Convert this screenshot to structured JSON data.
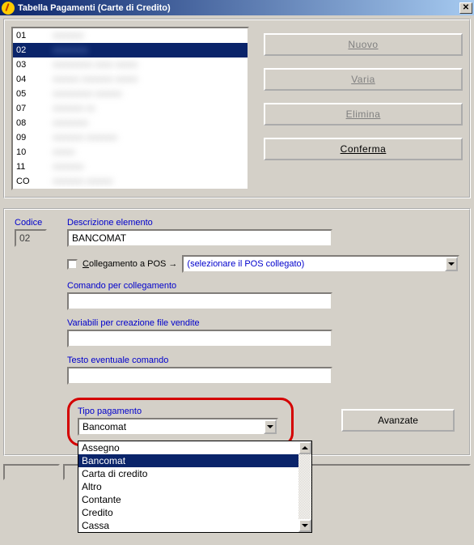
{
  "window": {
    "title": "Tabella Pagamenti (Carte di Credito)"
  },
  "list": {
    "items": [
      {
        "code": "01",
        "desc": "xxxxxxx"
      },
      {
        "code": "02",
        "desc": "xxxxxxxx"
      },
      {
        "code": "03",
        "desc": "xxxxxxxxx xxxx xxxxx"
      },
      {
        "code": "04",
        "desc": "xxxxxx xxxxxxx xxxxx"
      },
      {
        "code": "05",
        "desc": "xxxxxxxxx xxxxxx"
      },
      {
        "code": "07",
        "desc": "xxxxxxx xx"
      },
      {
        "code": "08",
        "desc": "xxxxxxxx"
      },
      {
        "code": "09",
        "desc": "xxxxxxx xxxxxxx"
      },
      {
        "code": "10",
        "desc": "xxxxx"
      },
      {
        "code": "11",
        "desc": "xxxxxxx"
      },
      {
        "code": "CO",
        "desc": "xxxxxxx xxxxxx"
      }
    ],
    "selected_index": 1
  },
  "buttons": {
    "nuovo": "Nuovo",
    "varia": "Varia",
    "elimina": "Elimina",
    "conferma": "Conferma",
    "avanzate": "Avanzate"
  },
  "form": {
    "codice_label": "Codice",
    "codice_value": "02",
    "desc_label": "Descrizione elemento",
    "desc_value": "BANCOMAT",
    "collegamento_label": "Collegamento a POS →",
    "pos_placeholder": "(selezionare il POS collegato)",
    "comando_label": "Comando per collegamento",
    "comando_value": "",
    "variabili_label": "Variabili per creazione file vendite",
    "variabili_value": "",
    "testo_label": "Testo eventuale comando",
    "testo_value": ""
  },
  "tipo": {
    "label": "Tipo pagamento",
    "value": "Bancomat",
    "options": [
      "Assegno",
      "Bancomat",
      "Carta di credito",
      "Altro",
      "Contante",
      "Credito",
      "Cassa"
    ],
    "selected_option_index": 1
  }
}
